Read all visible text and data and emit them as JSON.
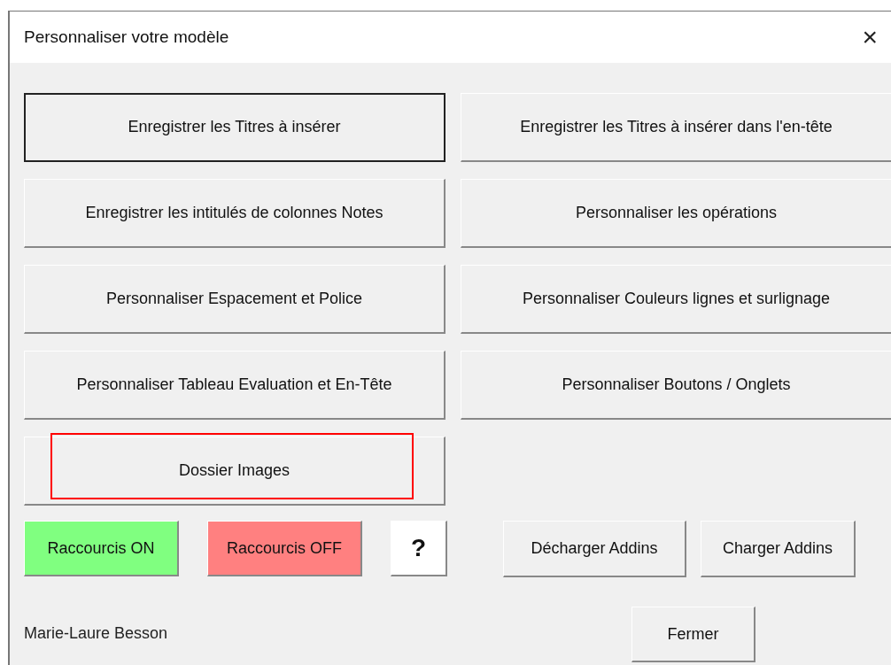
{
  "window": {
    "title": "Personnaliser votre modèle",
    "close": "×"
  },
  "buttons": [
    {
      "label": "Enregistrer les Titres à insérer",
      "focused": true,
      "highlighted": false
    },
    {
      "label": "Enregistrer les Titres à insérer dans l'en-tête",
      "focused": false,
      "highlighted": false
    },
    {
      "label": "Enregistrer les intitulés de colonnes Notes",
      "focused": false,
      "highlighted": false
    },
    {
      "label": "Personnaliser les opérations",
      "focused": false,
      "highlighted": false
    },
    {
      "label": "Personnaliser Espacement et Police",
      "focused": false,
      "highlighted": false
    },
    {
      "label": "Personnaliser Couleurs lignes et surlignage",
      "focused": false,
      "highlighted": false
    },
    {
      "label": "Personnaliser Tableau Evaluation et En-Tête",
      "focused": false,
      "highlighted": false
    },
    {
      "label": "Personnaliser Boutons  /  Onglets",
      "focused": false,
      "highlighted": false
    },
    {
      "label": "Dossier Images",
      "focused": false,
      "highlighted": true
    }
  ],
  "shortcut_buttons": [
    {
      "label": "Raccourcis ON",
      "color": "#80ff80"
    },
    {
      "label": "Raccourcis OFF",
      "color": "#ff8080"
    },
    {
      "label": "?",
      "color": "#ffffff"
    }
  ],
  "addin_buttons": [
    "Décharger Addins",
    "Charger Addins"
  ],
  "author": "Marie-Laure Besson",
  "close_button": "Fermer"
}
